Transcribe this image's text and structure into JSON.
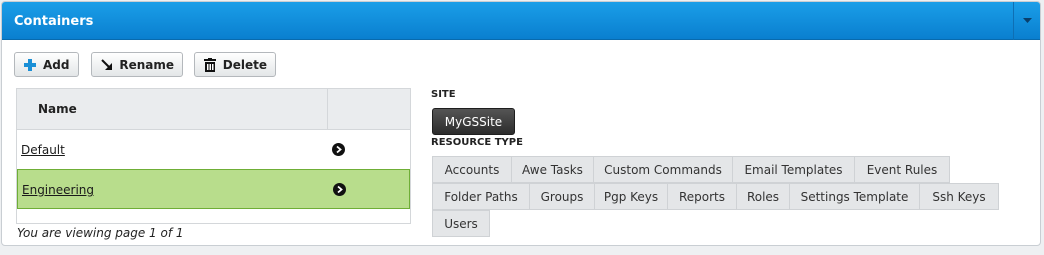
{
  "panel": {
    "title": "Containers"
  },
  "toolbar": {
    "add_label": "Add",
    "rename_label": "Rename",
    "delete_label": "Delete"
  },
  "grid": {
    "column_name": "Name",
    "rows": [
      {
        "name": "Default",
        "selected": false
      },
      {
        "name": "Engineering",
        "selected": true
      }
    ],
    "pager_text": "You are viewing page 1 of 1"
  },
  "site": {
    "label": "SITE",
    "value": "MyGSSite"
  },
  "resource_type": {
    "label": "RESOURCE TYPE",
    "tabs": [
      "Accounts",
      "Awe Tasks",
      "Custom Commands",
      "Email Templates",
      "Event Rules",
      "Folder Paths",
      "Groups",
      "Pgp Keys",
      "Reports",
      "Roles",
      "Settings Template",
      "Ssh Keys",
      "Users"
    ]
  },
  "colors": {
    "header_blue": "#0a87d8",
    "selected_row": "#b8dd8c",
    "add_icon": "#1a8fd6"
  }
}
